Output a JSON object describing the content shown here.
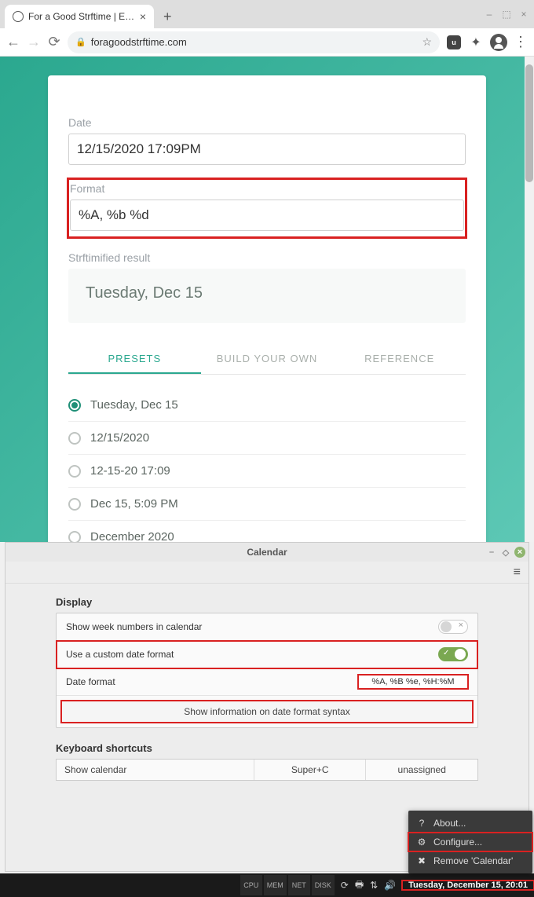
{
  "browser": {
    "tab_title": "For a Good Strftime | Easy Ske",
    "url": "foragoodstrftime.com"
  },
  "strftime": {
    "date_label": "Date",
    "date_value": "12/15/2020 17:09PM",
    "format_label": "Format",
    "format_value": "%A, %b %d",
    "result_label": "Strftimified result",
    "result_value": "Tuesday, Dec 15",
    "tabs": [
      "PRESETS",
      "BUILD YOUR OWN",
      "REFERENCE"
    ],
    "presets": [
      "Tuesday, Dec 15",
      "12/15/2020",
      "12-15-20 17:09",
      "Dec 15, 5:09 PM",
      "December 2020"
    ],
    "selected_preset": 0
  },
  "calendar": {
    "title": "Calendar",
    "display_heading": "Display",
    "row_weeknums": "Show week numbers in calendar",
    "row_custom": "Use a custom date format",
    "row_dateformat": "Date format",
    "dateformat_value": "%A, %B %e, %H:%M",
    "info_btn": "Show information on date format syntax",
    "kb_heading": "Keyboard shortcuts",
    "kb_row": {
      "label": "Show calendar",
      "binding1": "Super+C",
      "binding2": "unassigned"
    }
  },
  "context_menu": {
    "items": [
      {
        "icon": "?",
        "label": "About..."
      },
      {
        "icon": "⚙",
        "label": "Configure..."
      },
      {
        "icon": "✖",
        "label": "Remove 'Calendar'"
      }
    ]
  },
  "taskbar": {
    "monitors": [
      "CPU",
      "MEM",
      "NET",
      "DISK"
    ],
    "clock": "Tuesday, December 15, 20:01"
  }
}
